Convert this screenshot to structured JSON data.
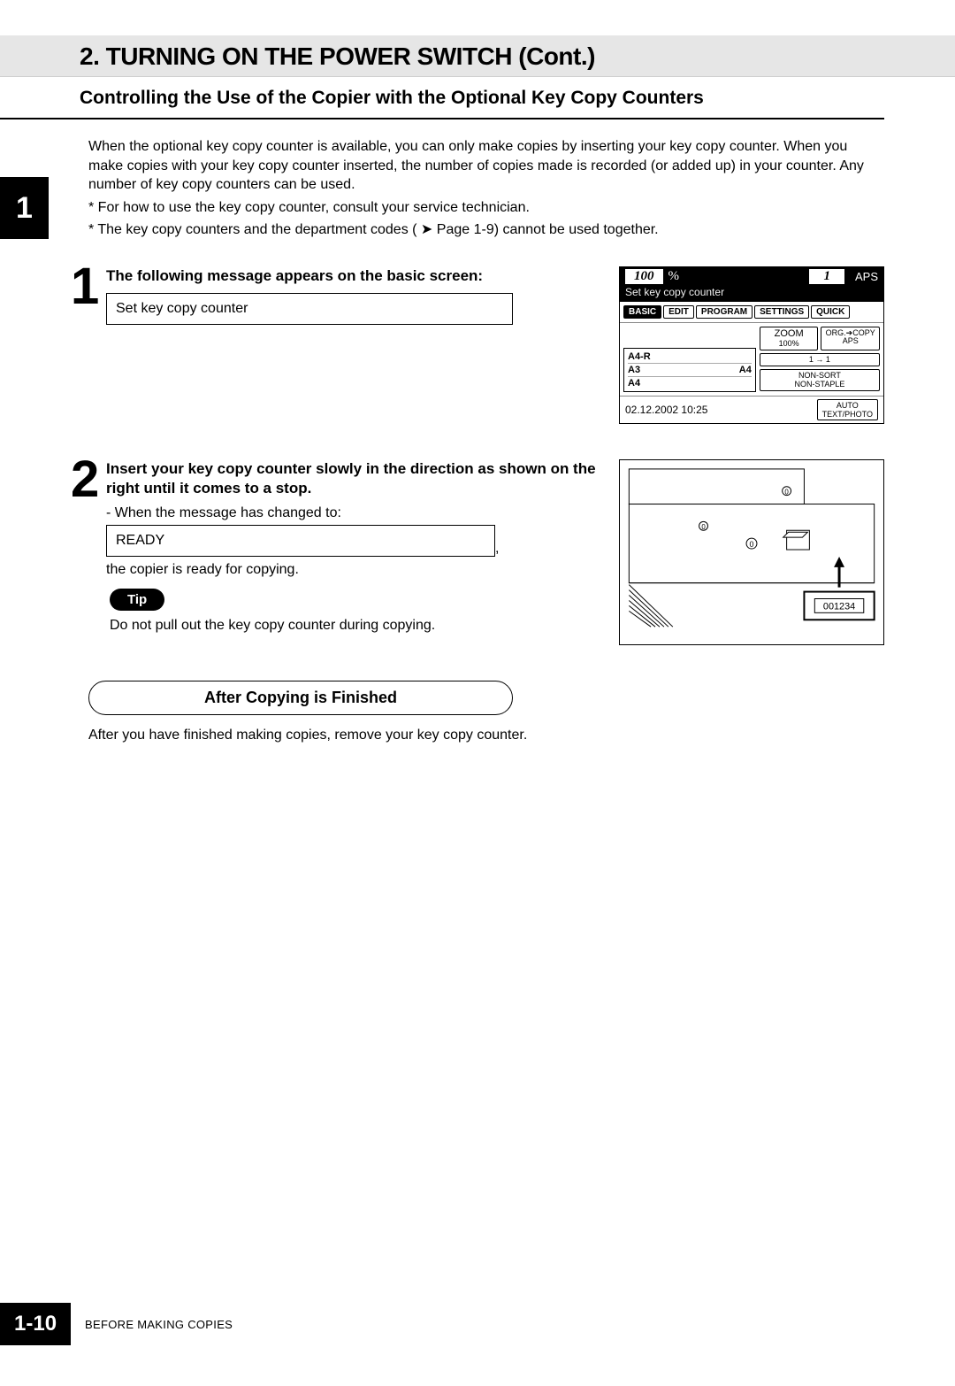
{
  "header": {
    "chapter_badge": "1",
    "title": "2. TURNING ON THE POWER SWITCH (Cont.)",
    "subtitle": "Controlling the Use of the Copier with the Optional Key Copy Counters"
  },
  "intro": {
    "para": "When the optional key copy counter is available, you can only make copies by inserting your key copy counter. When you make copies with your key copy counter inserted, the number of copies made is recorded (or added up) in your counter. Any number of key copy counters can be used.",
    "note1": "* For how to use the key copy counter, consult your service technician.",
    "note2": "* The key copy counters and the department codes ( ➤ Page 1-9) cannot be used together."
  },
  "steps": [
    {
      "num": "1",
      "heading": "The following message appears on the basic screen:",
      "message": "Set key copy counter"
    },
    {
      "num": "2",
      "heading": "Insert your key copy counter slowly in the direction as shown on the right until it comes to a stop.",
      "subline": "-  When the message has changed to:",
      "ready": "READY",
      "after_ready_trailing": ",",
      "after_ready": "the copier is ready for copying.",
      "tip_label": "Tip",
      "tip_text": "Do not pull out the key copy counter during copying."
    }
  ],
  "finish": {
    "lozenge": "After Copying is Finished",
    "text": "After you have finished making copies, remove your key copy counter."
  },
  "screen": {
    "zoom_value": "100",
    "zoom_suffix": "%",
    "qty": "1",
    "aps": "APS",
    "msg": "Set key copy counter",
    "tabs": [
      "BASIC",
      "EDIT",
      "PROGRAM",
      "SETTINGS",
      "QUICK"
    ],
    "trays": [
      "A4-R",
      "A3",
      "A4"
    ],
    "tray_side": "A4",
    "btn_zoom_l1": "ZOOM",
    "btn_zoom_l2": "100%",
    "btn_org_l1": "ORG.➔COPY",
    "btn_org_l2": "APS",
    "btn_duplex": "1 → 1",
    "btn_sort": "NON-SORT\nNON-STAPLE",
    "btn_mode_l1": "AUTO",
    "btn_mode_l2": "TEXT/PHOTO",
    "timestamp": "02.12.2002 10:25"
  },
  "copier": {
    "counter_display": "001234"
  },
  "footer": {
    "page_num": "1-10",
    "caption": "BEFORE MAKING COPIES"
  }
}
